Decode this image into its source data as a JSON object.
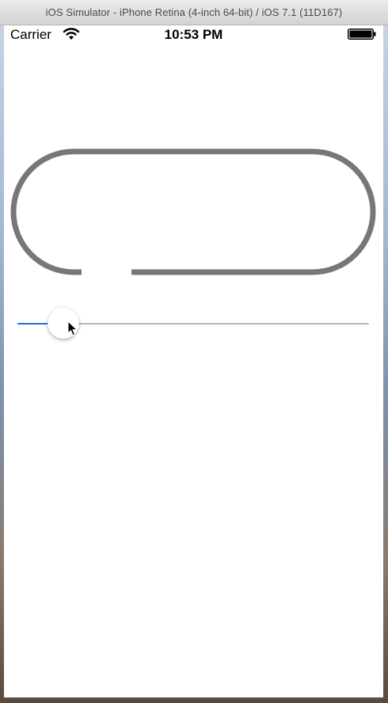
{
  "window": {
    "title": "iOS Simulator - iPhone Retina (4-inch 64-bit) / iOS 7.1 (11D167)"
  },
  "statusbar": {
    "carrier": "Carrier",
    "time": "10:53 PM",
    "wifi_icon": "wifi-icon",
    "battery_icon": "battery-icon"
  },
  "progress_shape": {
    "stroke_color": "#777777",
    "progress_fraction": 0.97
  },
  "slider": {
    "value": 0.13,
    "min": 0,
    "max": 1,
    "fill_color": "#1a73d9",
    "track_color": "#b6b6b6"
  },
  "cursor": {
    "icon": "arrow-cursor-icon"
  }
}
